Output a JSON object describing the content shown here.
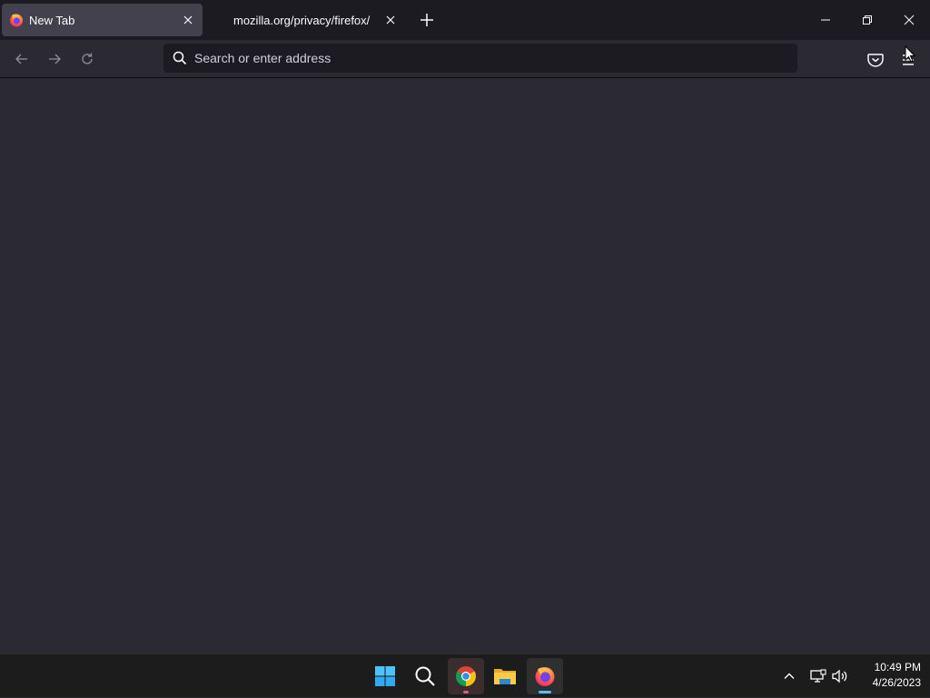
{
  "browser": {
    "tabs": [
      {
        "label": "New Tab",
        "active": true
      },
      {
        "label": "mozilla.org/privacy/firefox/",
        "active": false
      }
    ],
    "urlbar": {
      "value": "",
      "placeholder": "Search or enter address"
    }
  },
  "taskbar": {
    "apps": [
      "windows-start",
      "search",
      "google-chrome",
      "file-explorer",
      "firefox"
    ],
    "clock": {
      "time": "10:49 PM",
      "date": "4/26/2023"
    }
  },
  "colors": {
    "accent": "#4cc2ff",
    "content_bg": "#2b2a33",
    "tabstrip_bg": "#1c1b22"
  }
}
